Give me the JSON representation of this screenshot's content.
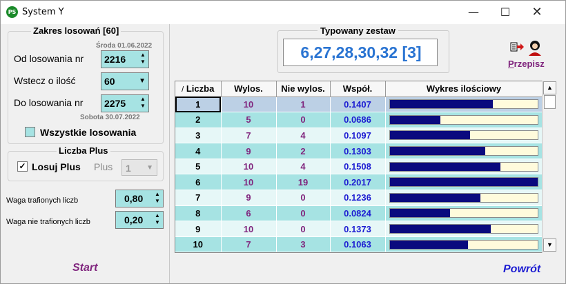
{
  "window": {
    "title": "System Y",
    "icon_text": "PS"
  },
  "range": {
    "legend": "Zakres losowań [60]",
    "from_date": "Środa 01.06.2022",
    "from_label": "Od losowania nr",
    "from_value": "2216",
    "back_label": "Wstecz o ilość",
    "back_value": "60",
    "to_label": "Do losowania nr",
    "to_value": "2275",
    "to_date": "Sobota 30.07.2022",
    "all_label": "Wszystkie losowania",
    "all_checked": false
  },
  "plus": {
    "legend": "Liczba Plus",
    "draw_label": "Losuj Plus",
    "draw_checked": true,
    "plus_label": "Plus",
    "plus_value": "1"
  },
  "weights": {
    "hit_label": "Waga trafionych liczb",
    "hit_value": "0,80",
    "miss_label": "Waga nie trafionych liczb",
    "miss_value": "0,20"
  },
  "typed_set": {
    "legend": "Typowany zestaw",
    "value": "6,27,28,30,32 [3]"
  },
  "przepisz": {
    "first_letter": "P",
    "rest": "rzepisz"
  },
  "table": {
    "columns": [
      "Liczba",
      "Wylos.",
      "Nie wylos.",
      "Współ.",
      "Wykres ilościowy"
    ],
    "sort_marker": "/",
    "rows": [
      {
        "num": "1",
        "wylos": "10",
        "nie": "1",
        "wspol": "0.1407"
      },
      {
        "num": "2",
        "wylos": "5",
        "nie": "0",
        "wspol": "0.0686"
      },
      {
        "num": "3",
        "wylos": "7",
        "nie": "4",
        "wspol": "0.1097"
      },
      {
        "num": "4",
        "wylos": "9",
        "nie": "2",
        "wspol": "0.1303"
      },
      {
        "num": "5",
        "wylos": "10",
        "nie": "4",
        "wspol": "0.1508"
      },
      {
        "num": "6",
        "wylos": "10",
        "nie": "19",
        "wspol": "0.2017"
      },
      {
        "num": "7",
        "wylos": "9",
        "nie": "0",
        "wspol": "0.1236"
      },
      {
        "num": "8",
        "wylos": "6",
        "nie": "0",
        "wspol": "0.0824"
      },
      {
        "num": "9",
        "wylos": "10",
        "nie": "0",
        "wspol": "0.1373"
      },
      {
        "num": "10",
        "wylos": "7",
        "nie": "3",
        "wspol": "0.1063"
      }
    ],
    "selected_index": 0,
    "bar_max": 0.2017
  },
  "footer": {
    "start_label": "Start",
    "back_label": "Powrót"
  },
  "colors": {
    "accent_purple": "#80267e",
    "accent_blue": "#1d1dd2",
    "bar": "#0a0a7e",
    "cell": "#a6e3e3"
  }
}
